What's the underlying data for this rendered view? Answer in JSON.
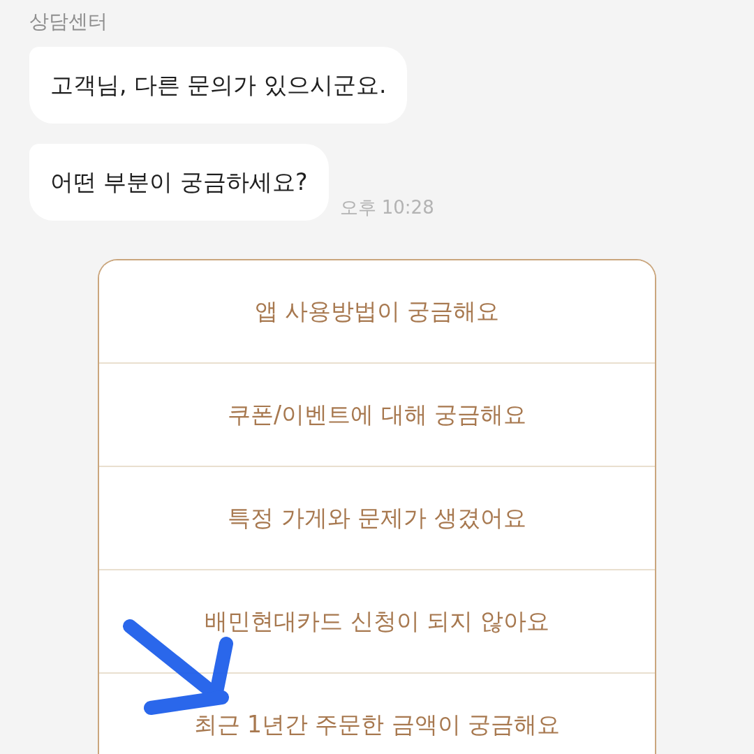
{
  "sender": "상담센터",
  "messages": [
    {
      "text": "고객님, 다른 문의가 있으시군요."
    },
    {
      "text": "어떤 부분이 궁금하세요?",
      "time": "오후 10:28"
    }
  ],
  "quick_replies": [
    {
      "label": "앱 사용방법이 궁금해요"
    },
    {
      "label": "쿠폰/이벤트에 대해 궁금해요"
    },
    {
      "label": "특정 가게와 문제가 생겼어요"
    },
    {
      "label": "배민현대카드 신청이 되지 않아요"
    },
    {
      "label": "최근 1년간 주문한 금액이 궁금해요"
    }
  ]
}
